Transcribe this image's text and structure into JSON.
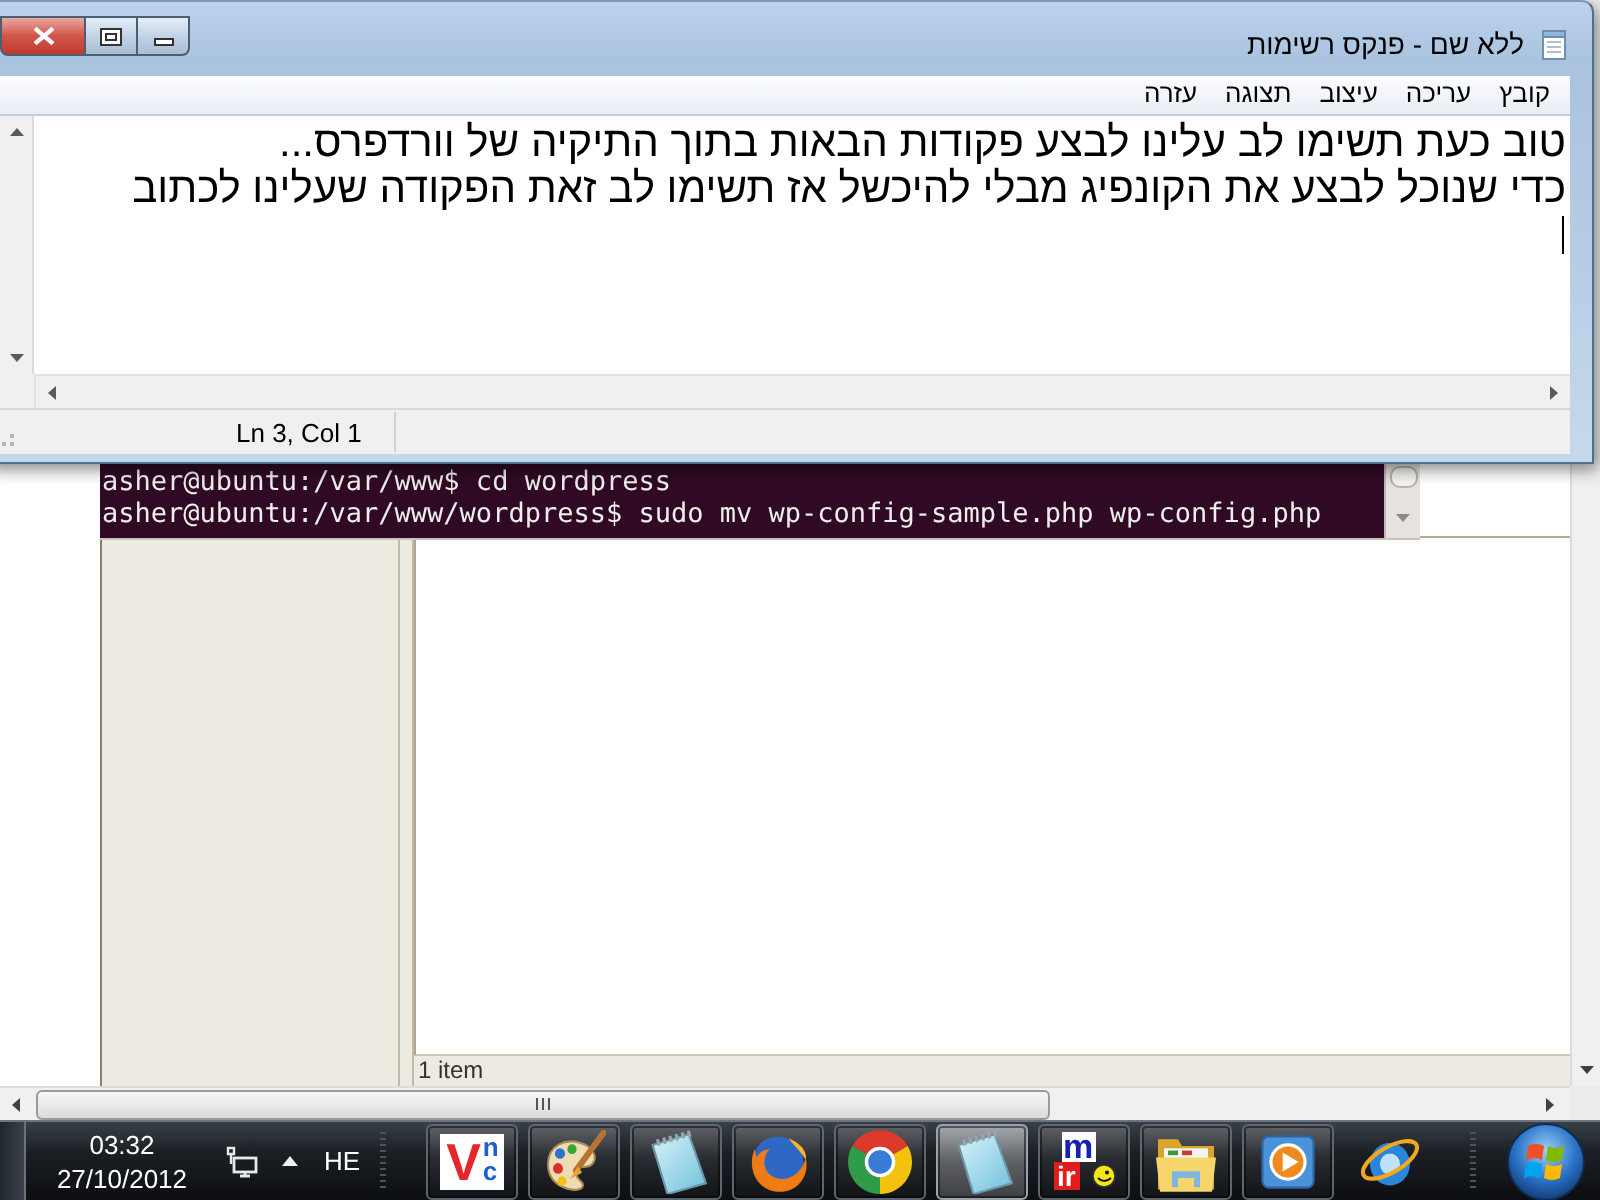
{
  "notepad": {
    "title": "ללא שם - פנקס רשימות",
    "menu": [
      "קובץ",
      "עריכה",
      "עיצוב",
      "תצוגה",
      "עזרה"
    ],
    "lines": [
      "טוב כעת תשימו לב עלינו לבצע פקודות הבאות בתוך התיקיה של וורדפרס...",
      "כדי שנוכל לבצע את הקונפיג מבלי להיכשל אז תשימו לב זאת הפקודה שעלינו לכתוב"
    ],
    "status": "Ln 3, Col 1"
  },
  "terminal": {
    "lines": [
      "asher@ubuntu:/var/www$ cd wordpress",
      "asher@ubuntu:/var/www/wordpress$ sudo mv wp-config-sample.php wp-config.php"
    ]
  },
  "file_manager": {
    "status": "1 item"
  },
  "taskbar": {
    "clock": {
      "time": "03:32",
      "date": "27/10/2012"
    },
    "language": "HE",
    "apps": [
      {
        "kind": "ie",
        "running": false,
        "selected": false
      },
      {
        "kind": "player",
        "running": true,
        "selected": false
      },
      {
        "kind": "folder",
        "running": true,
        "selected": false
      },
      {
        "kind": "mirc",
        "running": true,
        "selected": false,
        "logo_text": [
          "m",
          "ir"
        ]
      },
      {
        "kind": "notepad",
        "running": true,
        "selected": true
      },
      {
        "kind": "chrome",
        "running": true,
        "selected": false
      },
      {
        "kind": "firefox",
        "running": true,
        "selected": false
      },
      {
        "kind": "notepad",
        "running": true,
        "selected": false
      },
      {
        "kind": "palette",
        "running": true,
        "selected": false
      },
      {
        "kind": "vnc",
        "running": true,
        "selected": false,
        "logo_text": "Vnc"
      }
    ]
  }
}
